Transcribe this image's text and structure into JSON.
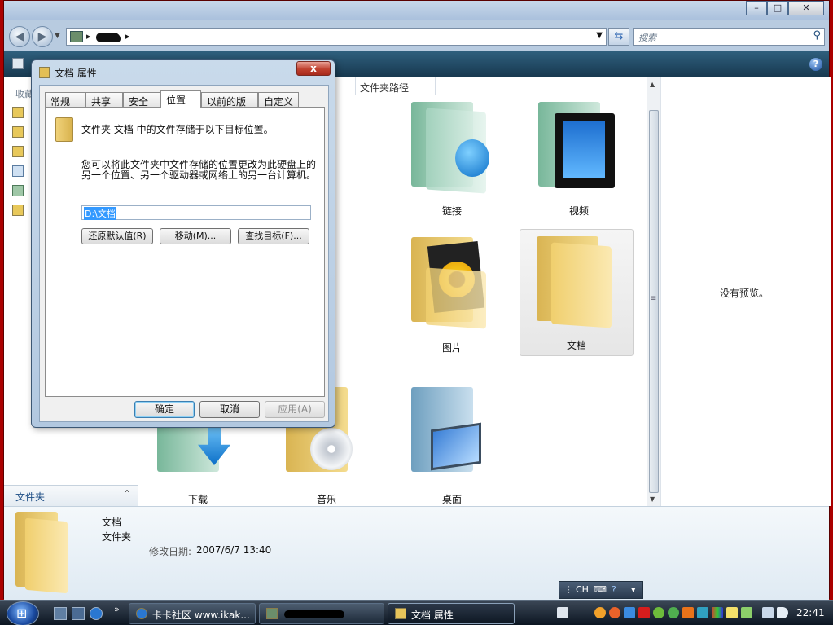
{
  "explorer": {
    "address": {
      "separator": "▸"
    },
    "search_placeholder": "搜索",
    "column_header": "文件夹路径",
    "left_pane": {
      "heading": "收藏",
      "folders_label": "文件夹"
    },
    "tiles": [
      {
        "label": "链接"
      },
      {
        "label": "视频"
      },
      {
        "label": "图片"
      },
      {
        "label": "文档"
      },
      {
        "label": "下载"
      },
      {
        "label": "音乐"
      },
      {
        "label": "桌面"
      }
    ],
    "preview_text": "没有预览。",
    "details": {
      "name": "文档",
      "type": "文件夹",
      "modified_label": "修改日期:",
      "modified_value": "2007/6/7 13:40"
    },
    "lang_bar": "CH"
  },
  "dialog": {
    "title": "文档 属性",
    "close": "x",
    "tabs": [
      "常规",
      "共享",
      "安全",
      "位置",
      "以前的版本",
      "自定义"
    ],
    "active_tab": "位置",
    "description": "文件夹 文档 中的文件存储于以下目标位置。",
    "paragraph": "您可以将此文件夹中文件存储的位置更改为此硬盘上的另一个位置、另一个驱动器或网络上的另一台计算机。",
    "path_value": "D:\\文档",
    "buttons": {
      "restore": "还原默认值(R)",
      "move": "移动(M)...",
      "find": "查找目标(F)..."
    },
    "ok": "确定",
    "cancel": "取消",
    "apply": "应用(A)"
  },
  "taskbar": {
    "buttons": [
      {
        "label": "卡卡社区 www.ikak..."
      },
      {
        "label": ""
      },
      {
        "label": "文档 属性"
      }
    ],
    "clock": "22:41"
  },
  "colors": {
    "title_red": "#a00000",
    "toolbar": "#1f4661",
    "accent": "#3399ff"
  }
}
